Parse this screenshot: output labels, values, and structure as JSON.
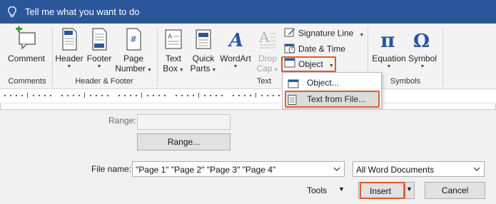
{
  "tell_me": {
    "text": "Tell me what you want to do"
  },
  "ribbon": {
    "comment": {
      "label": "Comment"
    },
    "header": {
      "label": "Header"
    },
    "footer": {
      "label": "Footer"
    },
    "page_number": {
      "label1": "Page",
      "label2": "Number"
    },
    "text_box": {
      "label1": "Text",
      "label2": "Box"
    },
    "quick_parts": {
      "label1": "Quick",
      "label2": "Parts"
    },
    "wordart": {
      "label": "WordArt"
    },
    "drop_cap": {
      "label1": "Drop",
      "label2": "Cap"
    },
    "signature_line": {
      "label": "Signature Line"
    },
    "date_time": {
      "label": "Date & Time"
    },
    "object": {
      "label": "Object"
    },
    "equation": {
      "label": "Equation"
    },
    "symbol": {
      "label": "Symbol"
    },
    "groups": {
      "comments": "Comments",
      "header_footer": "Header & Footer",
      "text": "Text",
      "symbols": "Symbols"
    }
  },
  "object_menu": {
    "items": [
      {
        "label": "Object..."
      },
      {
        "label": "Text from File..."
      }
    ]
  },
  "dialog": {
    "range_label": "Range:",
    "range_value": "",
    "range_button": "Range...",
    "filename_label": "File name:",
    "filename_value": "\"Page 1\" \"Page 2\" \"Page 3\" \"Page 4\"",
    "filetype_value": "All Word Documents",
    "tools_label": "Tools",
    "insert_label": "Insert",
    "cancel_label": "Cancel"
  },
  "colors": {
    "title_bar": "#2b579a",
    "highlight": "#e05a2b",
    "icon_blue": "#2b579a"
  }
}
